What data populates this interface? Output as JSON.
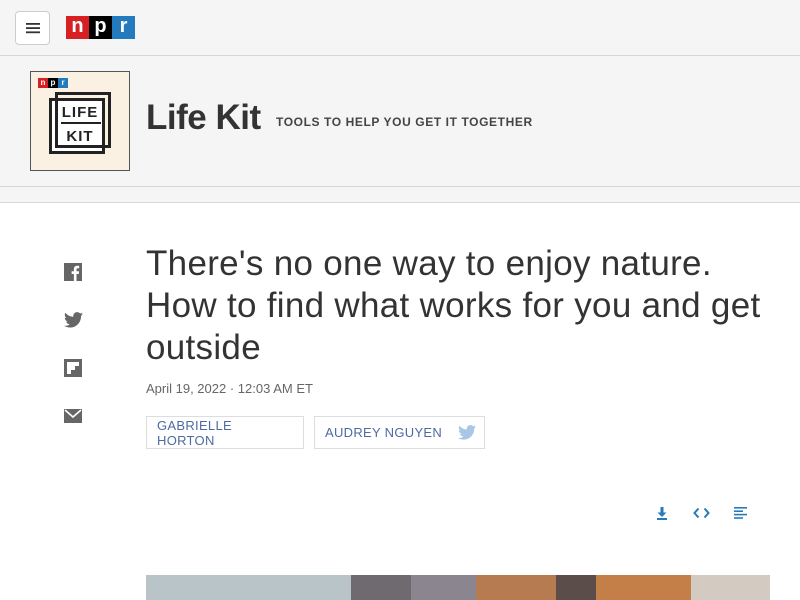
{
  "nav": {
    "menu_icon": "hamburger-icon",
    "logo_letters": [
      "n",
      "p",
      "r"
    ],
    "logo_colors": [
      "#d62021",
      "#000000",
      "#237bbd"
    ]
  },
  "show": {
    "art_npr": [
      "n",
      "p",
      "r"
    ],
    "art_line1": "LIFE",
    "art_line2": "KIT",
    "name": "Life Kit",
    "tagline": "TOOLS TO HELP YOU GET IT TOGETHER"
  },
  "share": {
    "icons": [
      "facebook-icon",
      "twitter-icon",
      "flipboard-icon",
      "email-icon"
    ]
  },
  "article": {
    "headline": "There's no one way to enjoy nature. How to find what works for you and get outside",
    "dateline": "April 19, 2022 · 12:03 AM ET",
    "bylines": [
      "GABRIELLE HORTON",
      "AUDREY NGUYEN"
    ]
  },
  "audio_tools": [
    "download-icon",
    "embed-icon",
    "transcript-icon"
  ],
  "colors": {
    "accent_link": "#4d6aa3",
    "tool_blue": "#237bbd",
    "twitter_gray": "#a8c7e6"
  }
}
